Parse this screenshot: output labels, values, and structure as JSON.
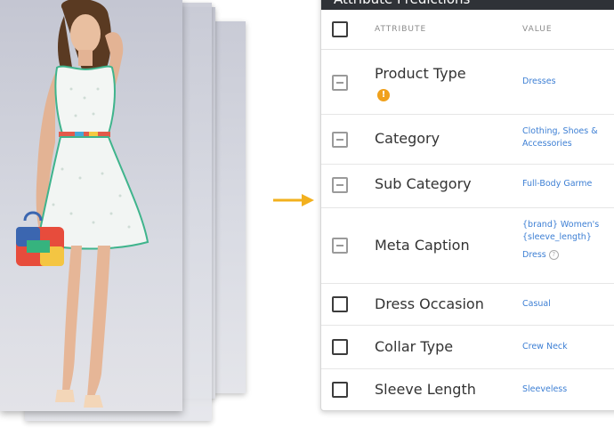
{
  "panel": {
    "title": "Attribute Predictions",
    "col_attribute": "ATTRIBUTE",
    "col_value": "VALUE"
  },
  "rows": [
    {
      "label": "Product Type",
      "value_lines": [
        "Dresses"
      ],
      "state": "collapsed",
      "info": "!"
    },
    {
      "label": "Category",
      "value_lines": [
        "Clothing, Shoes &",
        "Accessories"
      ],
      "state": "collapsed"
    },
    {
      "label": "Sub Category",
      "value_lines": [
        "Full-Body Garme"
      ],
      "state": "collapsed"
    },
    {
      "label": "Meta Caption",
      "value_lines": [
        "{brand} Women's",
        "{sleeve_length}",
        "Dress"
      ],
      "state": "collapsed"
    },
    {
      "label": "Dress Occasion",
      "value_lines": [
        "Casual"
      ],
      "state": "unchecked"
    },
    {
      "label": "Collar Type",
      "value_lines": [
        "Crew Neck"
      ],
      "state": "unchecked"
    },
    {
      "label": "Sleeve Length",
      "value_lines": [
        "Sleeveless"
      ],
      "state": "unchecked"
    }
  ],
  "colors": {
    "header_bg": "#2f3237",
    "link": "#3d7fd4",
    "arrow": "#f2b01e",
    "info_badge": "#f0a11c"
  },
  "icons": {
    "arrow": "right-arrow-icon",
    "info": "info-badge-icon",
    "help": "help-circle-icon"
  }
}
